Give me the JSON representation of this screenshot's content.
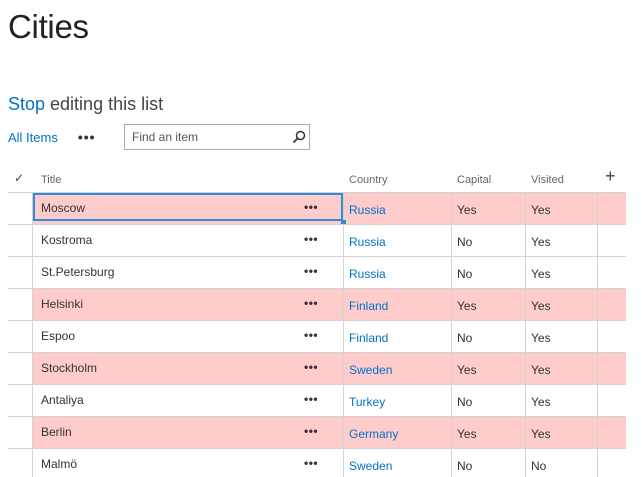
{
  "page": {
    "title": "Cities",
    "stop_link": "Stop",
    "stop_rest": " editing this list"
  },
  "view_bar": {
    "all_items": "All Items",
    "more": "•••",
    "search_placeholder": "Find an item"
  },
  "grid": {
    "columns": {
      "check": "✓",
      "title": "Title",
      "country": "Country",
      "capital": "Capital",
      "visited": "Visited",
      "add": "+"
    },
    "row_menu": "•••",
    "rows": [
      {
        "title": "Moscow",
        "country": "Russia",
        "capital": "Yes",
        "visited": "Yes",
        "highlighted": true
      },
      {
        "title": "Kostroma",
        "country": "Russia",
        "capital": "No",
        "visited": "Yes",
        "highlighted": false
      },
      {
        "title": "St.Petersburg",
        "country": "Russia",
        "capital": "No",
        "visited": "Yes",
        "highlighted": false
      },
      {
        "title": "Helsinki",
        "country": "Finland",
        "capital": "Yes",
        "visited": "Yes",
        "highlighted": true
      },
      {
        "title": "Espoo",
        "country": "Finland",
        "capital": "No",
        "visited": "Yes",
        "highlighted": false
      },
      {
        "title": "Stockholm",
        "country": "Sweden",
        "capital": "Yes",
        "visited": "Yes",
        "highlighted": true
      },
      {
        "title": "Antaliya",
        "country": "Turkey",
        "capital": "No",
        "visited": "Yes",
        "highlighted": false
      },
      {
        "title": "Berlin",
        "country": "Germany",
        "capital": "Yes",
        "visited": "Yes",
        "highlighted": true
      },
      {
        "title": "Malmö",
        "country": "Sweden",
        "capital": "No",
        "visited": "No",
        "highlighted": false
      }
    ]
  },
  "colors": {
    "link": "#0072c6",
    "highlight_row": "#ffcccc",
    "active_cell_border": "#2e8bd6"
  },
  "icons": {
    "search": "search-icon",
    "check": "checkmark-icon",
    "add_column": "plus-icon"
  }
}
